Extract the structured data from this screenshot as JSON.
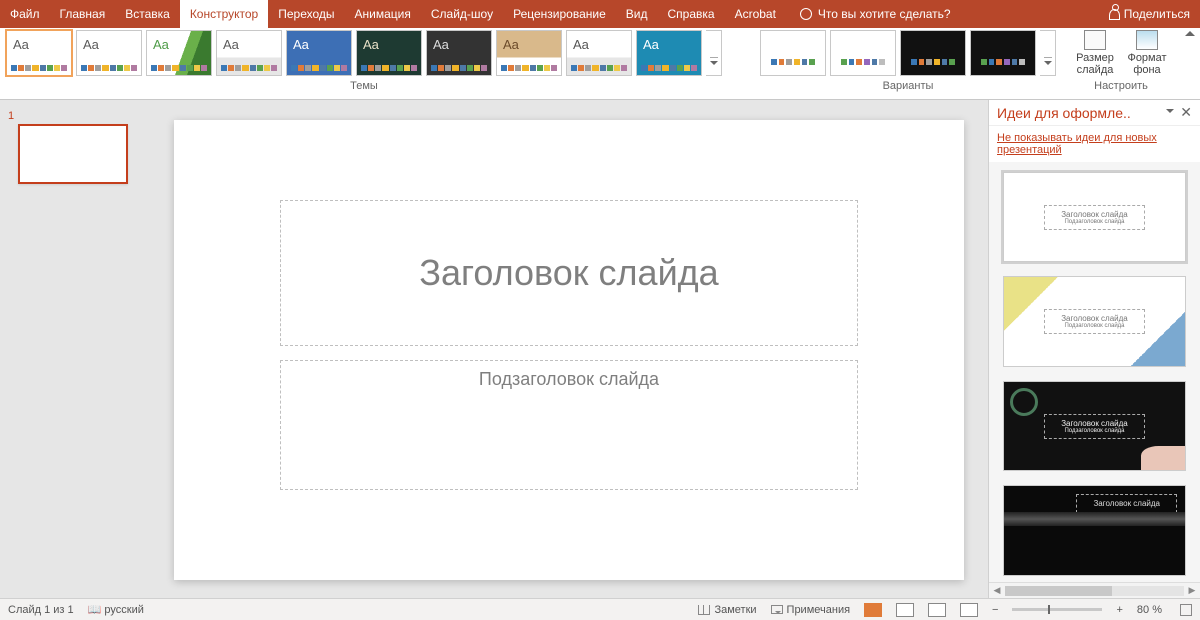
{
  "menu": {
    "items": [
      "Файл",
      "Главная",
      "Вставка",
      "Конструктор",
      "Переходы",
      "Анимация",
      "Слайд-шоу",
      "Рецензирование",
      "Вид",
      "Справка",
      "Acrobat"
    ],
    "active": 3,
    "tell": "Что вы хотите сделать?",
    "share": "Поделиться"
  },
  "ribbon": {
    "themes_label": "Темы",
    "variants_label": "Варианты",
    "custom_label": "Настроить",
    "size_label": "Размер слайда",
    "size_suffix": "▾",
    "format_label": "Формат фона",
    "themes": [
      {
        "aa": "Aa",
        "bg": "#fff",
        "fg": "#5A5A5A",
        "accent": "rainbow",
        "sel": true
      },
      {
        "aa": "Aa",
        "bg": "#fff",
        "fg": "#5A5A5A",
        "accent": "rainbow"
      },
      {
        "aa": "Aa",
        "bg": "#fff",
        "fg": "#4E9B47",
        "accent": "green",
        "swoosh": "#6AB04A"
      },
      {
        "aa": "Aa",
        "bg": "#fff",
        "fg": "#5A5A5A",
        "accent": "rainbow",
        "band": "#E6E6E6"
      },
      {
        "aa": "Aa",
        "bg": "#3D6FB5",
        "fg": "#fff",
        "accent": "blue",
        "pattern": true
      },
      {
        "aa": "Aa",
        "bg": "#1E3A32",
        "fg": "#E8E1C8",
        "accent": "olive"
      },
      {
        "aa": "Aa",
        "bg": "#333333",
        "fg": "#ddd",
        "accent": "rainbow"
      },
      {
        "aa": "Aa",
        "bg": "#D9B98B",
        "fg": "#6b4a2a",
        "accent": "tan",
        "band": "#fff"
      },
      {
        "aa": "Aa",
        "bg": "#fff",
        "fg": "#555",
        "accent": "grey",
        "band": "#E6E6E6"
      },
      {
        "aa": "Aa",
        "bg": "#1E8BB3",
        "fg": "#fff",
        "accent": "cyan"
      }
    ],
    "variants": [
      {
        "bg": "#fff",
        "palette": [
          "#3B78B5",
          "#E07B39",
          "#9E9E9E",
          "#F0B429",
          "#4E79A7",
          "#59A14F"
        ]
      },
      {
        "bg": "#fff",
        "palette": [
          "#59A14F",
          "#3B78B5",
          "#E07B39",
          "#9467BD",
          "#4E79A7",
          "#BDBDBD"
        ]
      },
      {
        "bg": "#111",
        "palette": [
          "#3B78B5",
          "#E07B39",
          "#9E9E9E",
          "#F0B429",
          "#4E79A7",
          "#59A14F"
        ]
      },
      {
        "bg": "#111",
        "palette": [
          "#59A14F",
          "#3B78B5",
          "#E07B39",
          "#9467BD",
          "#4E79A7",
          "#BDBDBD"
        ]
      }
    ]
  },
  "thumb": {
    "num": "1"
  },
  "slide": {
    "title": "Заголовок слайда",
    "subtitle": "Подзаголовок слайда"
  },
  "ideas": {
    "title": "Идеи для оформле..",
    "link": "Не показывать идеи для новых презентаций",
    "cards": [
      {
        "title": "Заголовок слайда",
        "sub": "Подзаголовок слайда"
      },
      {
        "title": "Заголовок слайда",
        "sub": "Подзаголовок слайда"
      },
      {
        "title": "Заголовок слайда",
        "sub": "Подзаголовок слайда"
      },
      {
        "title": "Заголовок слайда",
        "sub": ""
      }
    ]
  },
  "status": {
    "slide": "Слайд 1 из 1",
    "lang": "русский",
    "notes": "Заметки",
    "comments": "Примечания",
    "zoom": "80 %"
  }
}
